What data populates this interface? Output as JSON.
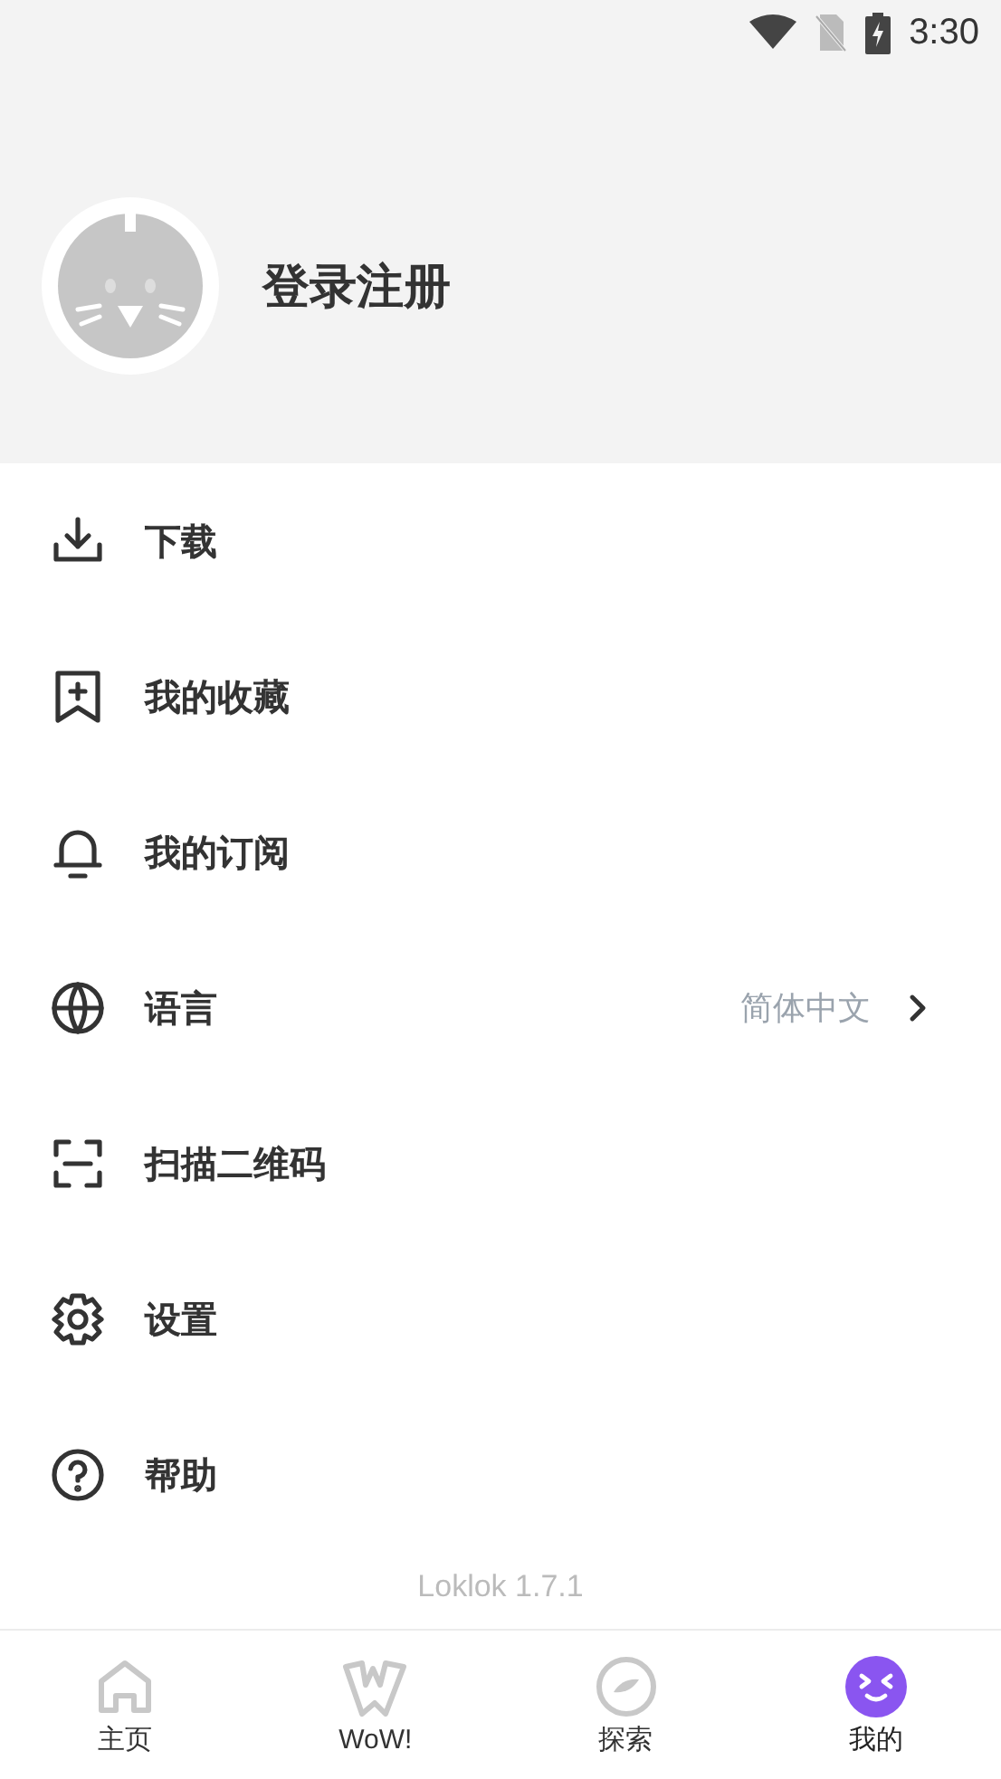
{
  "status_bar": {
    "time": "3:30"
  },
  "profile": {
    "name": "登录注册"
  },
  "menu": [
    {
      "label": "下载"
    },
    {
      "label": "我的收藏"
    },
    {
      "label": "我的订阅"
    },
    {
      "label": "语言",
      "value": "简体中文"
    },
    {
      "label": "扫描二维码"
    },
    {
      "label": "设置"
    },
    {
      "label": "帮助"
    }
  ],
  "version": "Loklok 1.7.1",
  "tabs": [
    {
      "label": "主页",
      "selected": false
    },
    {
      "label": "WoW!",
      "selected": false
    },
    {
      "label": "探索",
      "selected": false
    },
    {
      "label": "我的",
      "selected": true
    }
  ]
}
